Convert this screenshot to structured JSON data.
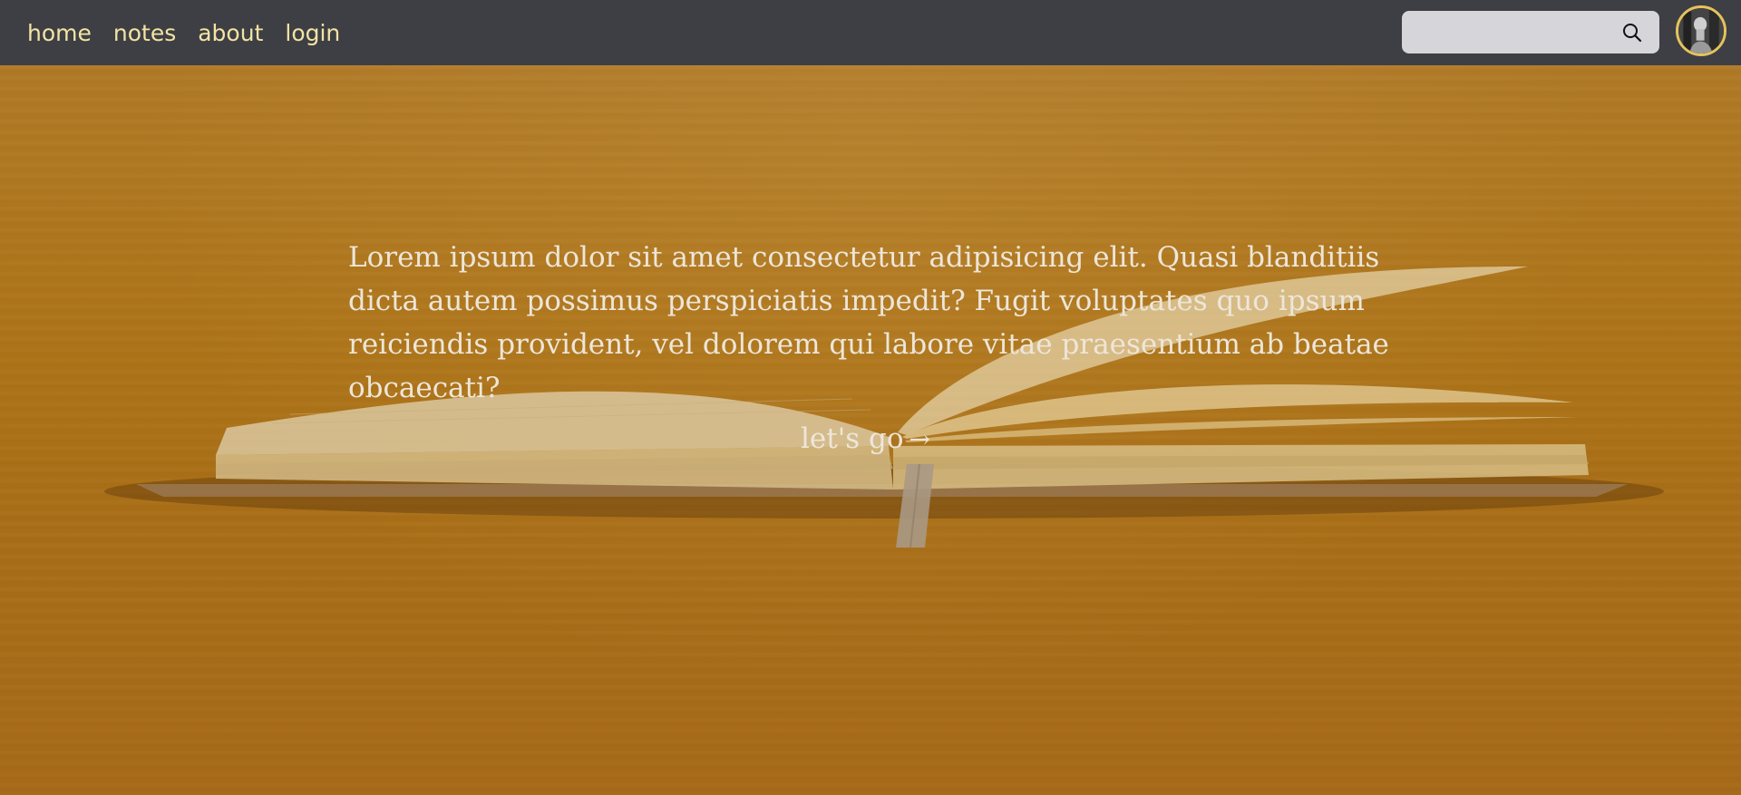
{
  "nav": {
    "links": [
      {
        "label": "home"
      },
      {
        "label": "notes"
      },
      {
        "label": "about"
      },
      {
        "label": "login"
      }
    ]
  },
  "search": {
    "value": "",
    "placeholder": "",
    "icon": "search-icon"
  },
  "user": {
    "avatar_icon": "user-avatar"
  },
  "hero": {
    "text": "Lorem ipsum dolor sit amet consectetur adipisicing elit. Quasi blanditiis dicta autem possimus perspiciatis impedit? Fugit voluptates quo ipsum reiciendis provident, vel dolorem qui labore vitae praesentium ab beatae obcaecati?",
    "cta_label": "let's go",
    "cta_arrow": "→"
  },
  "colors": {
    "nav_bg": "#3d3f44",
    "nav_link": "#f3e3a3",
    "background": "#ad7519",
    "hero_text": "#ede6d9",
    "avatar_border": "#e7c25c"
  }
}
